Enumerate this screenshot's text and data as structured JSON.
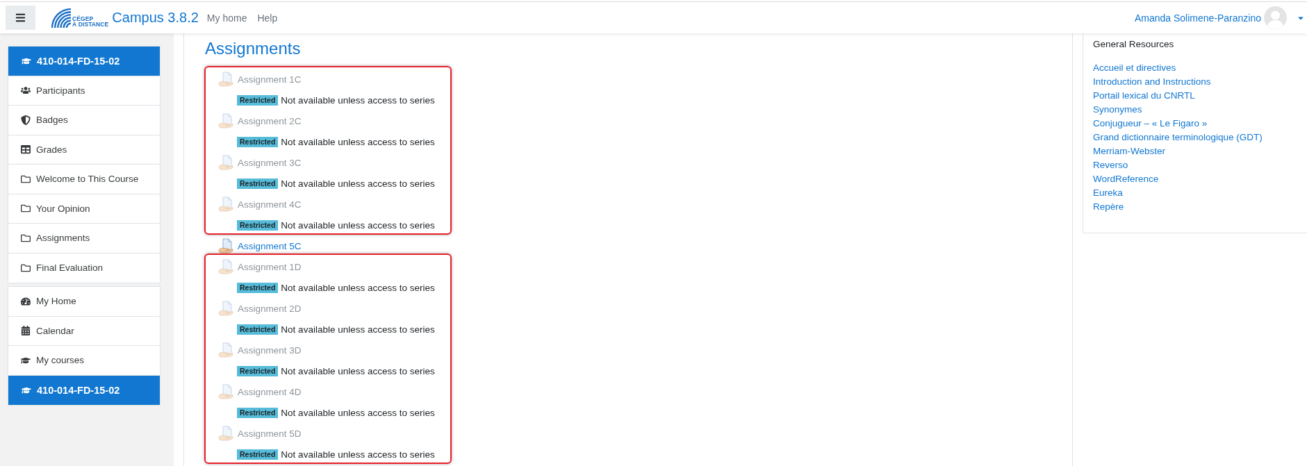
{
  "header": {
    "logo": {
      "line_1": "CÉGEP",
      "line_2": "À DISTANCE"
    },
    "site_name": "Campus 3.8.2",
    "nav_links": [
      "My home",
      "Help"
    ],
    "user": {
      "name": "Amanda Solimene-Paranzino"
    }
  },
  "nav_drawer": {
    "groups": [
      {
        "items": [
          {
            "label": "410-014-FD-15-02",
            "kind": "course",
            "selected": true
          },
          {
            "label": "Participants",
            "kind": "participants",
            "selected": false
          },
          {
            "label": "Badges",
            "kind": "badges",
            "selected": false
          },
          {
            "label": "Grades",
            "kind": "grades",
            "selected": false
          },
          {
            "label": "Welcome to This Course",
            "kind": "section",
            "selected": false
          },
          {
            "label": "Your Opinion",
            "kind": "section",
            "selected": false
          },
          {
            "label": "Assignments",
            "kind": "section",
            "selected": false
          },
          {
            "label": "Final Evaluation",
            "kind": "section",
            "selected": false
          }
        ]
      },
      {
        "items": [
          {
            "label": "My Home",
            "kind": "dashboard",
            "selected": false
          },
          {
            "label": "Calendar",
            "kind": "calendar",
            "selected": false
          },
          {
            "label": "My courses",
            "kind": "mycourses",
            "selected": false
          },
          {
            "label": "410-014-FD-15-02",
            "kind": "course",
            "selected": true
          }
        ]
      }
    ]
  },
  "main": {
    "title": "Assignments",
    "groups": [
      {
        "highlighted": true,
        "items": [
          {
            "name": "Assignment 1C",
            "available": false,
            "restriction": {
              "badge": "Restricted",
              "text": "Not available unless access to series"
            }
          },
          {
            "name": "Assignment 2C",
            "available": false,
            "restriction": {
              "badge": "Restricted",
              "text": "Not available unless access to series"
            }
          },
          {
            "name": "Assignment 3C",
            "available": false,
            "restriction": {
              "badge": "Restricted",
              "text": "Not available unless access to series"
            }
          },
          {
            "name": "Assignment 4C",
            "available": false,
            "restriction": {
              "badge": "Restricted",
              "text": "Not available unless access to series"
            }
          }
        ]
      },
      {
        "highlighted": false,
        "items": [
          {
            "name": "Assignment 5C",
            "available": true
          }
        ]
      },
      {
        "highlighted": true,
        "items": [
          {
            "name": "Assignment 1D",
            "available": false,
            "restriction": {
              "badge": "Restricted",
              "text": "Not available unless access to series"
            }
          },
          {
            "name": "Assignment 2D",
            "available": false,
            "restriction": {
              "badge": "Restricted",
              "text": "Not available unless access to series"
            }
          },
          {
            "name": "Assignment 3D",
            "available": false,
            "restriction": {
              "badge": "Restricted",
              "text": "Not available unless access to series"
            }
          },
          {
            "name": "Assignment 4D",
            "available": false,
            "restriction": {
              "badge": "Restricted",
              "text": "Not available unless access to series"
            }
          },
          {
            "name": "Assignment 5D",
            "available": false,
            "restriction": {
              "badge": "Restricted",
              "text": "Not available unless access to series"
            }
          }
        ]
      }
    ]
  },
  "resources_block": {
    "title": "General Resources",
    "links": [
      "Accueil et directives",
      "Introduction and Instructions",
      "Portail lexical du CNRTL",
      "Synonymes",
      "Conjugueur – « Le Figaro »",
      "Grand dictionnaire terminologique (GDT)",
      "Merriam-Webster",
      "Reverso",
      "WordReference",
      "Eureka",
      "Repère"
    ]
  }
}
